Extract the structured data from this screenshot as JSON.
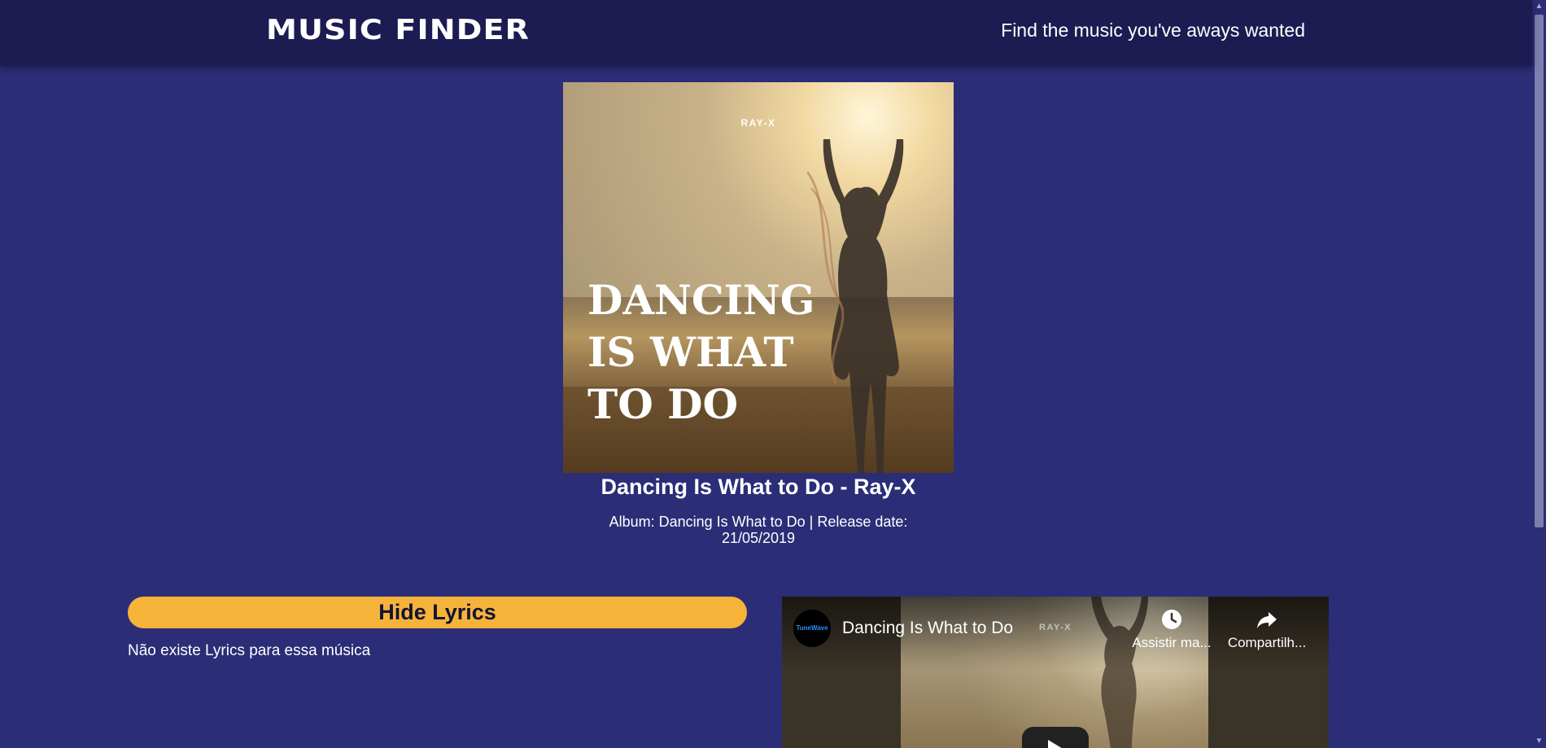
{
  "header": {
    "logo": "MUSIC FINDER",
    "tagline": "Find the music you've aways wanted"
  },
  "cover": {
    "brand": "RAY-X",
    "title": "DANCING\nIS WHAT\nTO DO"
  },
  "song": {
    "title": "Dancing Is What to Do - Ray-X",
    "meta": "Album: Dancing Is What to Do | Release date: 21/05/2019"
  },
  "lyrics": {
    "button_label": "Hide Lyrics",
    "message": "Não existe Lyrics para essa música"
  },
  "video": {
    "channel_avatar_text": "TuneWave",
    "title": "Dancing Is What to Do",
    "thumb_brand": "RAY-X",
    "watch_later_label": "Assistir ma...",
    "share_label": "Compartilh..."
  },
  "colors": {
    "page_background": "#2b2d77",
    "header_background": "#1c1c52",
    "button_accent": "#f6b33a"
  }
}
